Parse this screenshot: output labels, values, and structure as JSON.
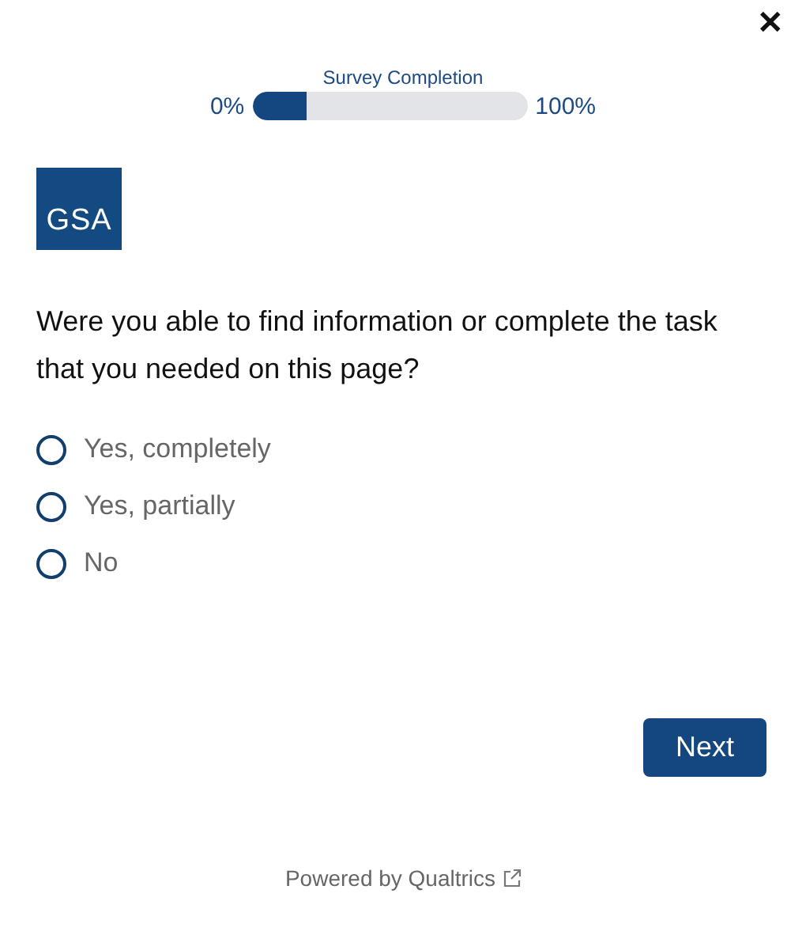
{
  "close": {
    "label": "✕"
  },
  "progress": {
    "title": "Survey Completion",
    "start": "0%",
    "end": "100%",
    "level": 0.2
  },
  "logo": {
    "text": "GSA"
  },
  "question": "Were you able to find information or complete the task that you needed on this page?",
  "options": [
    {
      "label": "Yes, completely",
      "selected": false
    },
    {
      "label": "Yes, partially",
      "selected": false
    },
    {
      "label": "No",
      "selected": false
    }
  ],
  "next_button": "Next",
  "footer": "Powered by Qualtrics"
}
